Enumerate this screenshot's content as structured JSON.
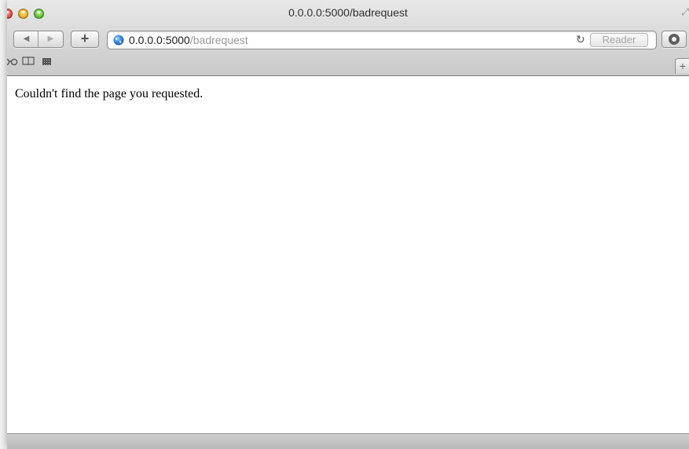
{
  "window": {
    "title": "0.0.0.0:5000/badrequest"
  },
  "toolbar": {
    "back_icon": "◀",
    "forward_icon": "▶",
    "add_label": "+",
    "url_host": "0.0.0.0:5000",
    "url_path": "/badrequest",
    "reload_icon": "↻",
    "reader_label": "Reader"
  },
  "bookmarks_bar": {
    "reading_list_icon": "⊖⊖",
    "bookmarks_icon": "📖",
    "newtab_label": "+"
  },
  "page": {
    "message": "Couldn't find the page you requested."
  },
  "colors": {
    "url_path": "#9a9a9a",
    "reader_disabled": "#a4a4a4",
    "close": "#ec4c42",
    "minimize": "#f3b32f",
    "zoom": "#69c43b"
  },
  "icons": {
    "close": "close-button-icon",
    "minimize": "minimize-button-icon",
    "zoom": "zoom-button-icon",
    "fullscreen": "fullscreen-icon",
    "globe": "globe-icon",
    "reload": "reload-icon",
    "downloads": "downloads-icon",
    "reading_list": "reading-list-icon",
    "bookmarks": "bookmarks-icon",
    "top_sites": "top-sites-grid-icon"
  }
}
